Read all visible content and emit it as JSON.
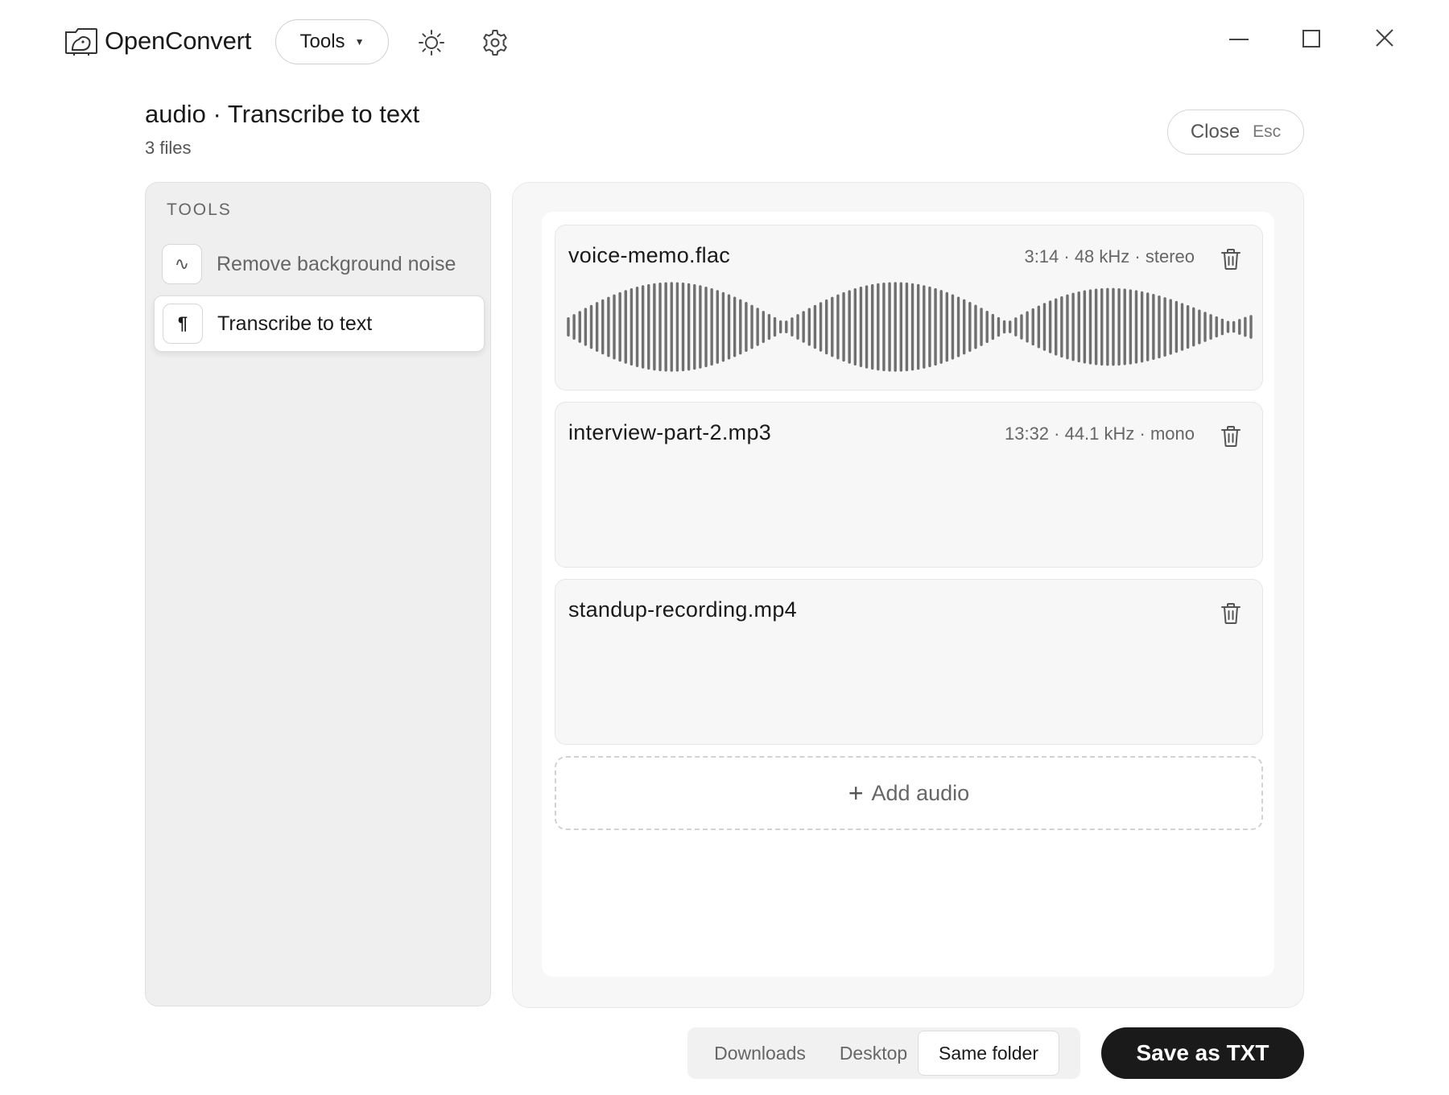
{
  "app": {
    "name": "OpenConvert",
    "tools_menu_label": "Tools",
    "icons": {
      "logo": "openconvert-logo-icon",
      "caret": "caret-down-icon",
      "theme": "sun-icon",
      "settings": "gear-icon",
      "minimize": "minimize-icon",
      "maximize": "maximize-icon",
      "close": "close-icon"
    }
  },
  "header": {
    "title": "audio · Transcribe to text",
    "subtitle": "3 files",
    "close_label": "Close",
    "close_shortcut": "Esc"
  },
  "tools_panel": {
    "heading": "TOOLS",
    "items": [
      {
        "icon": "∿",
        "icon_name": "wave-icon",
        "label": "Remove background noise",
        "selected": false
      },
      {
        "icon": "¶",
        "icon_name": "pilcrow-icon",
        "label": "Transcribe to text",
        "selected": true
      }
    ]
  },
  "files": [
    {
      "name": "voice-memo.flac",
      "meta": "3:14 · 48 kHz · stereo",
      "has_waveform": true
    },
    {
      "name": "interview-part-2.mp3",
      "meta": "13:32 · 44.1 kHz · mono",
      "has_waveform": false
    },
    {
      "name": "standup-recording.mp4",
      "meta": "",
      "has_waveform": false
    }
  ],
  "add_audio_label": "Add audio",
  "destination": {
    "options": [
      "Downloads",
      "Desktop",
      "Same folder"
    ],
    "selected": "Same folder"
  },
  "save_label": "Save as TXT",
  "colors": {
    "accent_dark": "#1a1a1a",
    "waveform": "#6f6f6f",
    "panel_bg": "#efefef"
  }
}
